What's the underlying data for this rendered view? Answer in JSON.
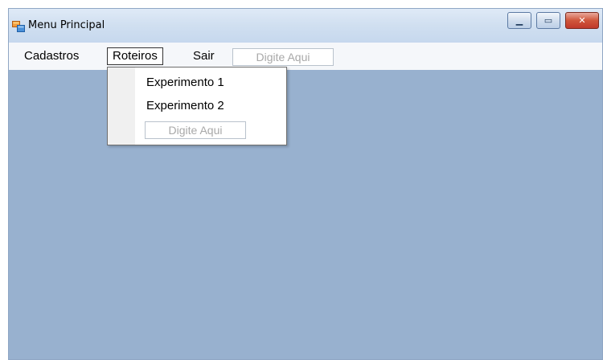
{
  "window": {
    "title": "Menu Principal",
    "app_icon": "windows-form-icon",
    "buttons": {
      "minimize_icon": "minimize-icon",
      "maximize_icon": "maximize-icon",
      "close_icon": "close-icon",
      "minimize_glyph": "▁",
      "maximize_glyph": "▭",
      "close_glyph": "✕"
    }
  },
  "menubar": {
    "items": [
      {
        "label": "Cadastros",
        "active": false
      },
      {
        "label": "Roteiros",
        "active": true
      },
      {
        "label": "Sair",
        "active": false
      }
    ],
    "type_here": "Digite Aqui"
  },
  "dropdown": {
    "parent": "Roteiros",
    "items": [
      {
        "label": "Experimento 1"
      },
      {
        "label": "Experimento 2"
      }
    ],
    "type_here": "Digite Aqui"
  },
  "colors": {
    "client_background": "#98b1cf",
    "menubar_background": "#f5f7fa",
    "placeholder_text": "#a8a8a8"
  }
}
